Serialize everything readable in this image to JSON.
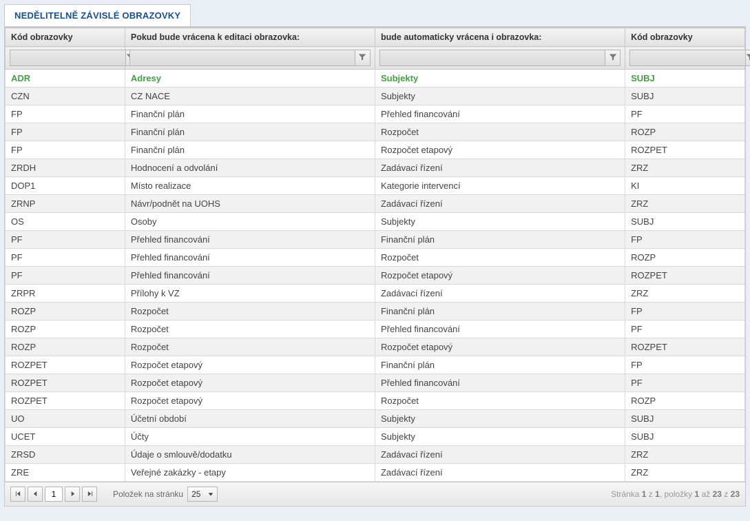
{
  "tab": {
    "title": "NEDĚLITELNĚ ZÁVISLÉ OBRAZOVKY"
  },
  "headers": {
    "col1": "Kód obrazovky",
    "col2": "Pokud bude vrácena k editaci obrazovka:",
    "col3": "bude automaticky vrácena i obrazovka:",
    "col4": "Kód obrazovky"
  },
  "filters": {
    "f1": "",
    "f2": "",
    "f3": "",
    "f4": ""
  },
  "rows": [
    {
      "c1": "ADR",
      "c2": "Adresy",
      "c3": "Subjekty",
      "c4": "SUBJ",
      "sel": true
    },
    {
      "c1": "CZN",
      "c2": "CZ NACE",
      "c3": "Subjekty",
      "c4": "SUBJ"
    },
    {
      "c1": "FP",
      "c2": "Finanční plán",
      "c3": "Přehled financování",
      "c4": "PF"
    },
    {
      "c1": "FP",
      "c2": "Finanční plán",
      "c3": "Rozpočet",
      "c4": "ROZP"
    },
    {
      "c1": "FP",
      "c2": "Finanční plán",
      "c3": "Rozpočet etapový",
      "c4": "ROZPET"
    },
    {
      "c1": "ZRDH",
      "c2": "Hodnocení a odvolání",
      "c3": "Zadávací řízení",
      "c4": "ZRZ"
    },
    {
      "c1": "DOP1",
      "c2": "Místo realizace",
      "c3": "Kategorie intervencí",
      "c4": "KI"
    },
    {
      "c1": "ZRNP",
      "c2": "Návr/podnět na UOHS",
      "c3": "Zadávací řízení",
      "c4": "ZRZ"
    },
    {
      "c1": "OS",
      "c2": "Osoby",
      "c3": "Subjekty",
      "c4": "SUBJ"
    },
    {
      "c1": "PF",
      "c2": "Přehled financování",
      "c3": "Finanční plán",
      "c4": "FP"
    },
    {
      "c1": "PF",
      "c2": "Přehled financování",
      "c3": "Rozpočet",
      "c4": "ROZP"
    },
    {
      "c1": "PF",
      "c2": "Přehled financování",
      "c3": "Rozpočet etapový",
      "c4": "ROZPET"
    },
    {
      "c1": "ZRPR",
      "c2": "Přílohy k VZ",
      "c3": "Zadávací řízení",
      "c4": "ZRZ"
    },
    {
      "c1": "ROZP",
      "c2": "Rozpočet",
      "c3": "Finanční plán",
      "c4": "FP"
    },
    {
      "c1": "ROZP",
      "c2": "Rozpočet",
      "c3": "Přehled financování",
      "c4": "PF"
    },
    {
      "c1": "ROZP",
      "c2": "Rozpočet",
      "c3": "Rozpočet etapový",
      "c4": "ROZPET"
    },
    {
      "c1": "ROZPET",
      "c2": "Rozpočet etapový",
      "c3": "Finanční plán",
      "c4": "FP"
    },
    {
      "c1": "ROZPET",
      "c2": "Rozpočet etapový",
      "c3": "Přehled financování",
      "c4": "PF"
    },
    {
      "c1": "ROZPET",
      "c2": "Rozpočet etapový",
      "c3": "Rozpočet",
      "c4": "ROZP"
    },
    {
      "c1": "UO",
      "c2": "Účetní období",
      "c3": "Subjekty",
      "c4": "SUBJ"
    },
    {
      "c1": "UCET",
      "c2": "Účty",
      "c3": "Subjekty",
      "c4": "SUBJ"
    },
    {
      "c1": "ZRSD",
      "c2": "Údaje o smlouvě/dodatku",
      "c3": "Zadávací řízení",
      "c4": "ZRZ"
    },
    {
      "c1": "ZRE",
      "c2": "Veřejné zakázky - etapy",
      "c3": "Zadávací řízení",
      "c4": "ZRZ"
    }
  ],
  "pager": {
    "page": "1",
    "per_page_label": "Položek na stránku",
    "per_page": "25",
    "summary_prefix": "Stránka",
    "summary_page_cur": "1",
    "summary_page_of": "z",
    "summary_page_tot": "1",
    "summary_items_prefix": ", položky",
    "summary_item_from": "1",
    "summary_item_to_word": "až",
    "summary_item_to": "23",
    "summary_item_of_word": "z",
    "summary_item_total": "23"
  }
}
